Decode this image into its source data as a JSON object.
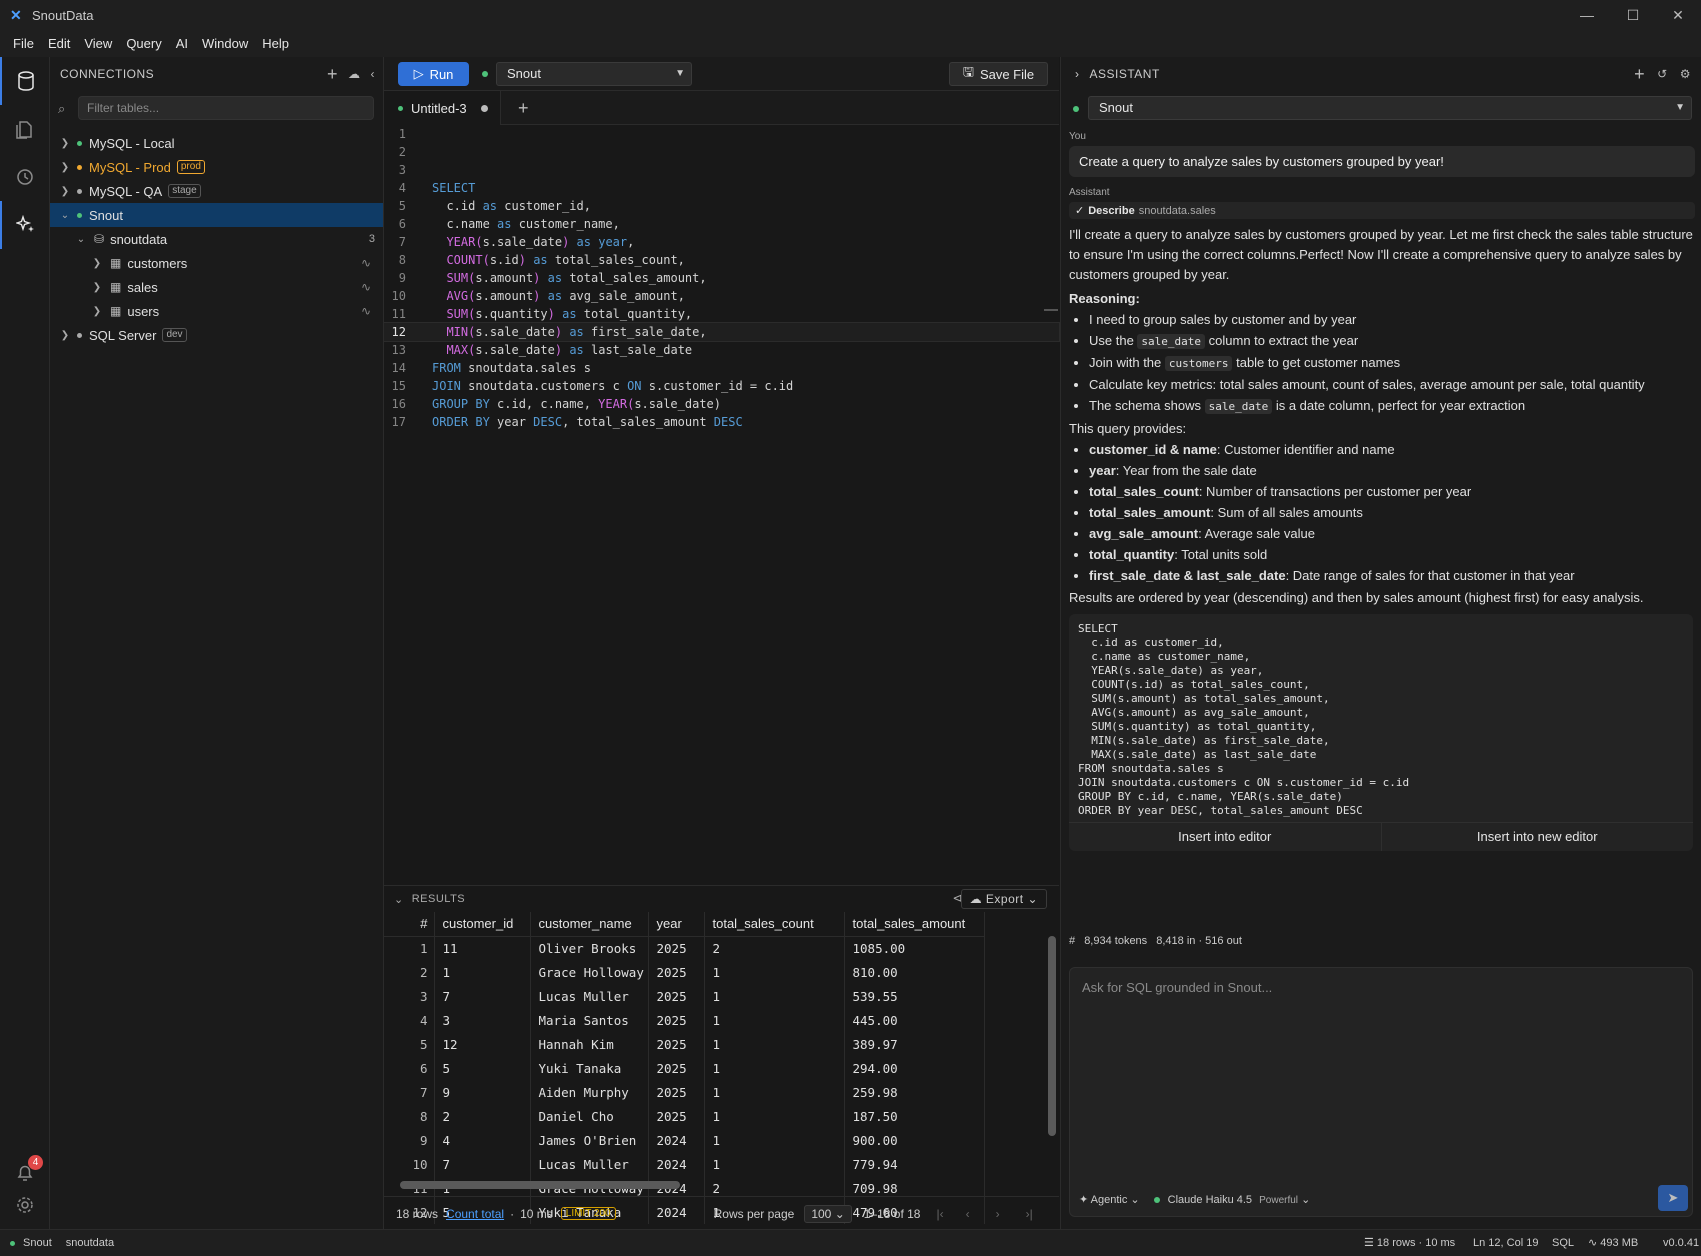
{
  "app": {
    "title": "SnoutData"
  },
  "menu": [
    "File",
    "Edit",
    "View",
    "Query",
    "AI",
    "Window",
    "Help"
  ],
  "sidebar": {
    "header": "CONNECTIONS",
    "filter_placeholder": "Filter tables...",
    "connections": [
      {
        "label": "MySQL - Local",
        "color": "#4ec27a",
        "tag": ""
      },
      {
        "label": "MySQL - Prod",
        "color": "#f0a830",
        "tag": "prod"
      },
      {
        "label": "MySQL - QA",
        "color": "#aaaaaa",
        "tag": "stage"
      },
      {
        "label": "Snout",
        "color": "#4ec27a",
        "tag": ""
      },
      {
        "label": "SQL Server",
        "color": "#aaaaaa",
        "tag": "dev"
      }
    ],
    "database": {
      "label": "snoutdata",
      "count": "3"
    },
    "tables": [
      "customers",
      "sales",
      "users"
    ]
  },
  "toolbar": {
    "run_label": "Run",
    "connection": "Snout",
    "save_label": "Save File"
  },
  "tabs": {
    "active": "Untitled-3"
  },
  "editor": {
    "current_line": 12,
    "lines": [
      "",
      "",
      "",
      "SELECT",
      "  c.id as customer_id,",
      "  c.name as customer_name,",
      "  YEAR(s.sale_date) as year,",
      "  COUNT(s.id) as total_sales_count,",
      "  SUM(s.amount) as total_sales_amount,",
      "  AVG(s.amount) as avg_sale_amount,",
      "  SUM(s.quantity) as total_quantity,",
      "  MIN(s.sale_date) as first_sale_date,",
      "  MAX(s.sale_date) as last_sale_date",
      "FROM snoutdata.sales s",
      "JOIN snoutdata.customers c ON s.customer_id = c.id",
      "GROUP BY c.id, c.name, YEAR(s.sale_date)",
      "ORDER BY year DESC, total_sales_amount DESC"
    ]
  },
  "results": {
    "header": "RESULTS",
    "export_label": "Export",
    "columns": [
      "#",
      "customer_id",
      "customer_name",
      "year",
      "total_sales_count",
      "total_sales_amount"
    ],
    "rows": [
      [
        "1",
        "11",
        "Oliver Brooks",
        "2025",
        "2",
        "1085.00"
      ],
      [
        "2",
        "1",
        "Grace Holloway",
        "2025",
        "1",
        "810.00"
      ],
      [
        "3",
        "7",
        "Lucas Muller",
        "2025",
        "1",
        "539.55"
      ],
      [
        "4",
        "3",
        "Maria Santos",
        "2025",
        "1",
        "445.00"
      ],
      [
        "5",
        "12",
        "Hannah Kim",
        "2025",
        "1",
        "389.97"
      ],
      [
        "6",
        "5",
        "Yuki Tanaka",
        "2025",
        "1",
        "294.00"
      ],
      [
        "7",
        "9",
        "Aiden Murphy",
        "2025",
        "1",
        "259.98"
      ],
      [
        "8",
        "2",
        "Daniel Cho",
        "2025",
        "1",
        "187.50"
      ],
      [
        "9",
        "4",
        "James O'Brien",
        "2024",
        "1",
        "900.00"
      ],
      [
        "10",
        "7",
        "Lucas Muller",
        "2024",
        "1",
        "779.94"
      ],
      [
        "11",
        "1",
        "Grace Holloway",
        "2024",
        "2",
        "709.98"
      ],
      [
        "12",
        "5",
        "Yuki Tanaka",
        "2024",
        "1",
        "479.60"
      ]
    ],
    "footer": {
      "rows": "18 rows",
      "count_link": "Count total",
      "sep": "·",
      "time": "10 ms",
      "limit": "LIMIT 200",
      "rows_per_page_label": "Rows per page",
      "rows_per_page": "100",
      "range": "1–18 of 18"
    }
  },
  "assistant": {
    "header": "ASSISTANT",
    "model_select": "Snout",
    "you_label": "You",
    "user_message": "Create a query to analyze sales by customers grouped by year!",
    "assistant_label": "Assistant",
    "tool": {
      "name": "Describe",
      "arg": "snoutdata.sales"
    },
    "intro": "I'll create a query to analyze sales by customers grouped by year. Let me first check the sales table structure to ensure I'm using the correct columns.Perfect! Now I'll create a comprehensive query to analyze sales by customers grouped by year.",
    "reasoning_label": "Reasoning:",
    "reasoning": [
      {
        "pre": "I need to group sales by customer and by year",
        "code": "",
        "post": ""
      },
      {
        "pre": "Use the ",
        "code": "sale_date",
        "post": " column to extract the year"
      },
      {
        "pre": "Join with the ",
        "code": "customers",
        "post": " table to get customer names"
      },
      {
        "pre": "Calculate key metrics: total sales amount, count of sales, average amount per sale, total quantity",
        "code": "",
        "post": ""
      },
      {
        "pre": "The schema shows ",
        "code": "sale_date",
        "post": " is a date column, perfect for year extraction"
      }
    ],
    "provides_label": "This query provides:",
    "provides": [
      {
        "term": "customer_id & name",
        "desc": ": Customer identifier and name"
      },
      {
        "term": "year",
        "desc": ": Year from the sale date"
      },
      {
        "term": "total_sales_count",
        "desc": ": Number of transactions per customer per year"
      },
      {
        "term": "total_sales_amount",
        "desc": ": Sum of all sales amounts"
      },
      {
        "term": "avg_sale_amount",
        "desc": ": Average sale value"
      },
      {
        "term": "total_quantity",
        "desc": ": Total units sold"
      },
      {
        "term": "first_sale_date & last_sale_date",
        "desc": ": Date range of sales for that customer in that year"
      }
    ],
    "order_note": "Results are ordered by year (descending) and then by sales amount (highest first) for easy analysis.",
    "code_block": "SELECT\n  c.id as customer_id,\n  c.name as customer_name,\n  YEAR(s.sale_date) as year,\n  COUNT(s.id) as total_sales_count,\n  SUM(s.amount) as total_sales_amount,\n  AVG(s.amount) as avg_sale_amount,\n  SUM(s.quantity) as total_quantity,\n  MIN(s.sale_date) as first_sale_date,\n  MAX(s.sale_date) as last_sale_date\nFROM snoutdata.sales s\nJOIN snoutdata.customers c ON s.customer_id = c.id\nGROUP BY c.id, c.name, YEAR(s.sale_date)\nORDER BY year DESC, total_sales_amount DESC",
    "insert_label": "Insert into editor",
    "insert_new_label": "Insert into new editor",
    "tokens": "8,934 tokens",
    "tokens_detail": "8,418 in · 516 out",
    "input_placeholder": "Ask for SQL grounded in Snout...",
    "mode": "Agentic",
    "model": "Claude Haiku 4.5",
    "model_tier": "Powerful"
  },
  "notifications": {
    "count": "4"
  },
  "status": {
    "connection": "Snout",
    "database": "snoutdata",
    "rows": "18 rows · 10 ms",
    "cursor": "Ln 12, Col 19",
    "lang": "SQL",
    "memory": "493 MB",
    "version": "v0.0.41"
  }
}
